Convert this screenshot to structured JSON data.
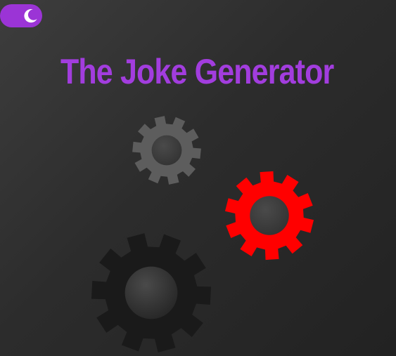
{
  "header": {
    "title": "The Joke Generator"
  },
  "theme_toggle": {
    "icon": "moon-icon",
    "state": "dark",
    "color": "#9b34d6"
  },
  "gears": [
    {
      "name": "gear-gray",
      "icon": "gear-icon",
      "color": "#5d5d5d"
    },
    {
      "name": "gear-red",
      "icon": "gear-icon",
      "color": "#ff0000"
    },
    {
      "name": "gear-black",
      "icon": "gear-icon",
      "color": "#1a1a1a"
    }
  ],
  "colors": {
    "title": "#a23dde",
    "background": "#2c2c2c",
    "gear_hub": "#333333"
  }
}
